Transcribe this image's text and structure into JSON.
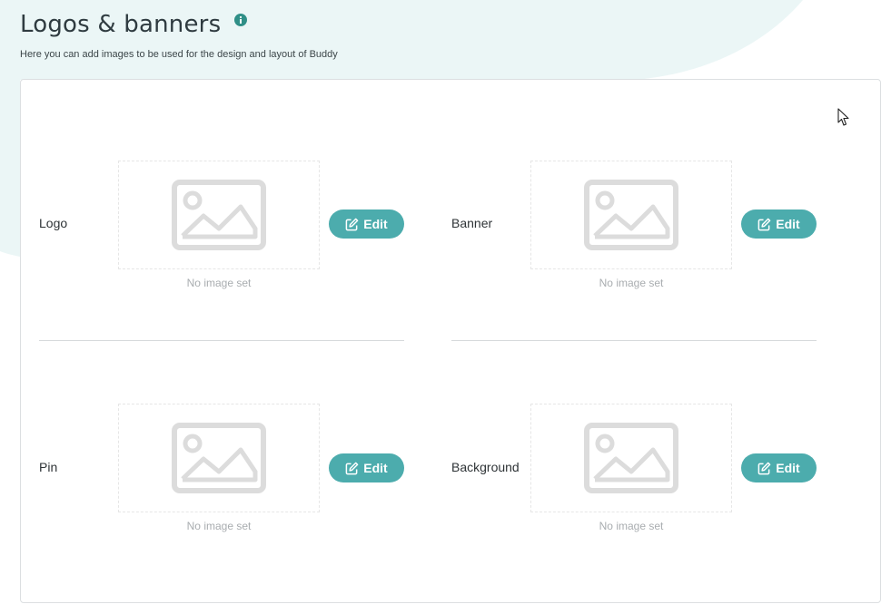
{
  "header": {
    "title": "Logos & banners",
    "subtitle": "Here you can add images to be used for the design and layout of Buddy"
  },
  "slots": [
    {
      "label": "Logo",
      "empty_text": "No image set",
      "button": "Edit"
    },
    {
      "label": "Banner",
      "empty_text": "No image set",
      "button": "Edit"
    },
    {
      "label": "Pin",
      "empty_text": "No image set",
      "button": "Edit"
    },
    {
      "label": "Background",
      "empty_text": "No image set",
      "button": "Edit"
    }
  ],
  "icons": {
    "info": "info-icon",
    "placeholder": "image-placeholder-icon",
    "edit": "edit-icon",
    "cursor": "mouse-cursor"
  },
  "colors": {
    "accent": "#4cacad",
    "info_icon": "#2f8f87",
    "background_blob": "#ebf6f6",
    "placeholder_icon": "#dcdcdc"
  }
}
